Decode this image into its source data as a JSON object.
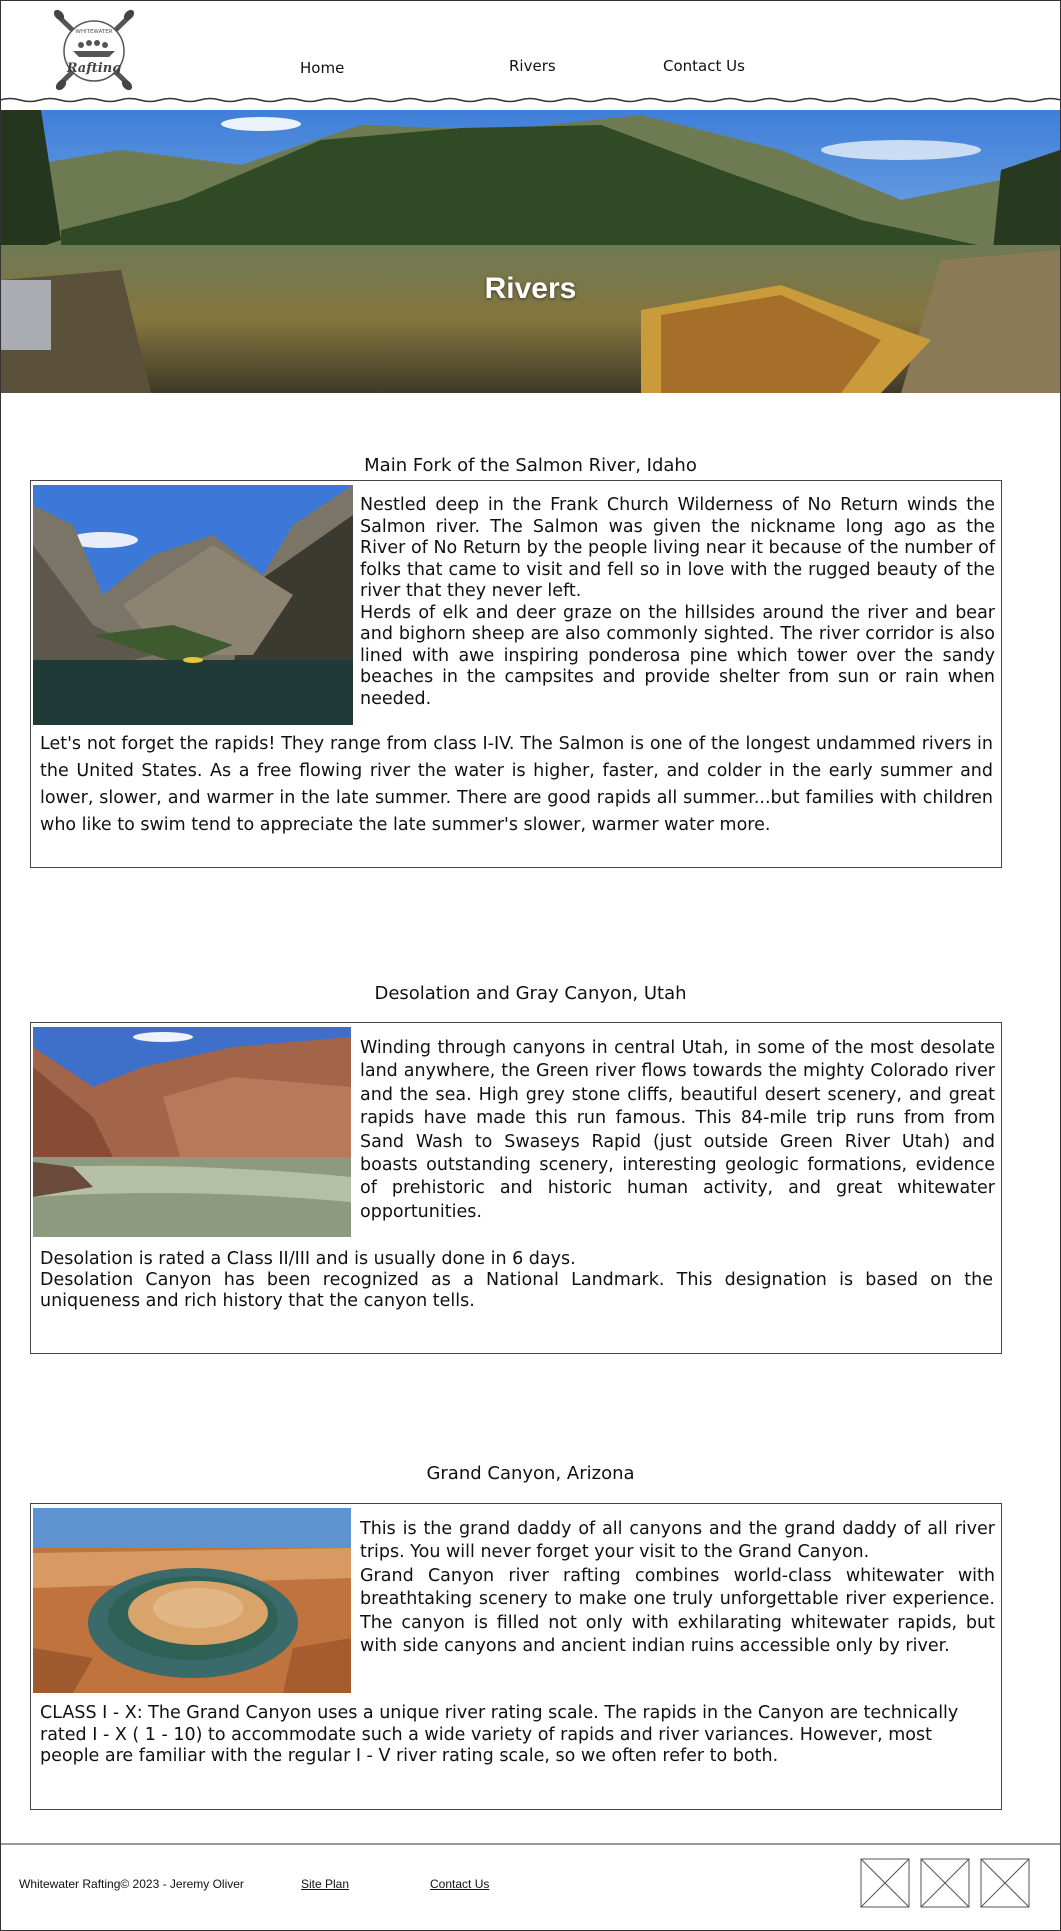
{
  "logo": {
    "top_text": "WHITEWATER",
    "script_text": "Rafting"
  },
  "nav": {
    "items": [
      "Home",
      "Rivers",
      "Contact Us"
    ]
  },
  "hero": {
    "title": "Rivers"
  },
  "rivers": [
    {
      "title": "Main Fork of the Salmon River, Idaho",
      "side_paragraphs": [
        "Nestled deep in the Frank Church Wilderness of No Return winds the Salmon river. The Salmon was given the nickname long ago as the River of No Return by the people living near it because of the number of folks that came to visit and fell so in love with the rugged beauty of the river that they never left.",
        "Herds of elk and deer graze on the hillsides around the river and bear and bighorn sheep are also commonly sighted. The river corridor is also lined with awe inspiring ponderosa pine which tower over the sandy beaches in the campsites and provide shelter from sun or rain when needed."
      ],
      "bottom_paragraphs": [
        "Let's not forget the rapids! They range from class I-IV. The Salmon is one of the longest undammed rivers in the United States. As a free flowing river the water is higher, faster, and colder in the early summer and lower, slower, and warmer in the late summer. There are good rapids all summer...but families with children who like to swim tend to appreciate the late summer's slower, warmer water more."
      ]
    },
    {
      "title": "Desolation and Gray Canyon, Utah",
      "side_paragraphs": [
        "Winding through canyons in central Utah, in some of the most desolate land anywhere, the Green river flows towards the mighty Colorado river and the sea. High grey stone cliffs, beautiful desert scenery, and great rapids have made this run famous. This 84-mile trip runs from from Sand Wash to Swaseys Rapid (just outside Green River Utah) and boasts outstanding scenery, interesting geologic formations, evidence of prehistoric and historic human activity, and great whitewater opportunities."
      ],
      "bottom_paragraphs": [
        "Desolation is rated a Class II/III and is usually done in 6 days.",
        "Desolation Canyon has been recognized as a National Landmark.  This designation is based on the uniqueness and rich history that the canyon tells."
      ]
    },
    {
      "title": "Grand Canyon, Arizona",
      "side_paragraphs": [
        "This is the grand daddy of all canyons and the grand daddy of all river trips. You will never forget your visit to the Grand Canyon.",
        "Grand Canyon river rafting combines world-class whitewater with breathtaking scenery to make one truly unforgettable river experience. The canyon is filled not only with exhilarating whitewater rapids, but with side canyons and ancient indian ruins accessible only by river."
      ],
      "bottom_paragraphs": [
        "CLASS I - X: The Grand Canyon uses a unique river rating scale. The rapids in the Canyon are technically rated I - X ( 1 - 10) to accommodate such a wide variety of rapids and river variances. However, most people are familiar with the regular I - V river rating scale, so we often refer to both."
      ]
    }
  ],
  "footer": {
    "copyright": "Whitewater Rafting© 2023 - Jeremy Oliver",
    "links": [
      "Site Plan",
      "Contact Us"
    ],
    "social_icons": [
      "placeholder-image-icon",
      "placeholder-image-icon",
      "placeholder-image-icon"
    ]
  }
}
